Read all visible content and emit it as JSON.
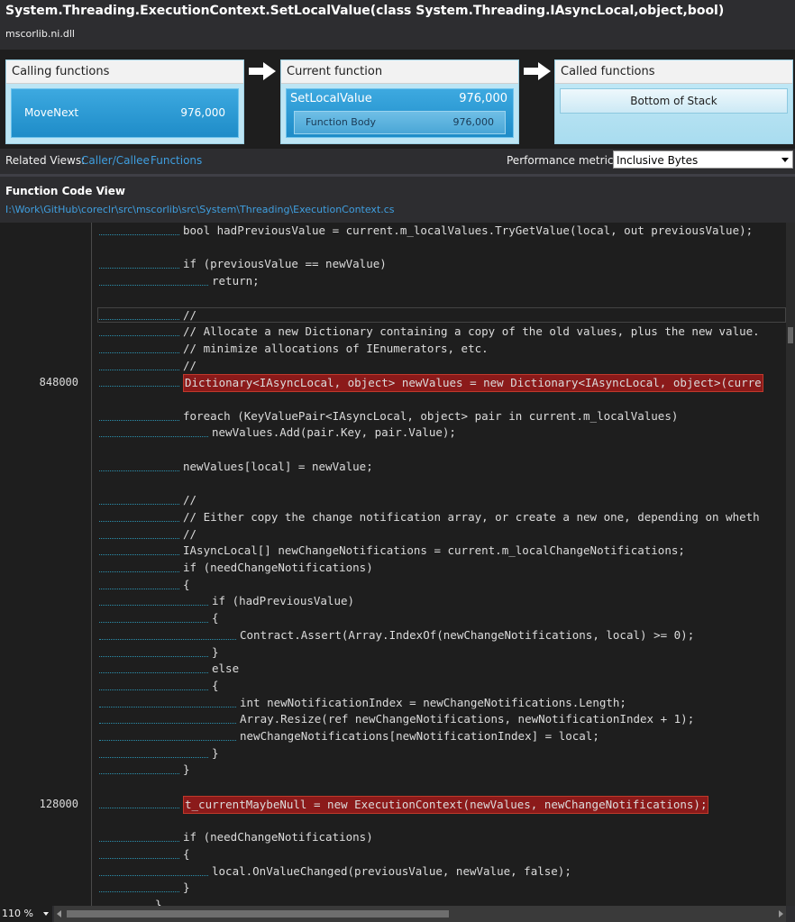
{
  "header": {
    "title": "System.Threading.ExecutionContext.SetLocalValue(class System.Threading.IAsyncLocal,object,bool)",
    "module": "mscorlib.ni.dll"
  },
  "calling": {
    "title": "Calling functions",
    "name": "MoveNext",
    "value": "976,000"
  },
  "current": {
    "title": "Current function",
    "name": "SetLocalValue",
    "value": "976,000",
    "body_label": "Function Body",
    "body_value": "976,000"
  },
  "called": {
    "title": "Called functions",
    "bottom_label": "Bottom of Stack"
  },
  "related": {
    "label": "Related Views:",
    "caller_callee": "Caller/Callee",
    "functions": "Functions",
    "metric_label": "Performance metric:",
    "metric_value": "Inclusive Bytes"
  },
  "code_view": {
    "title": "Function Code View",
    "path": "I:\\Work\\GitHub\\coreclr\\src\\mscorlib\\src\\System\\Threading\\ExecutionContext.cs",
    "lines": [
      {
        "num": "",
        "indent": 3,
        "text": "bool hadPreviousValue = current.m_localValues.TryGetValue(local, out previousValue);",
        "hot": false
      },
      {
        "num": "",
        "indent": 0,
        "text": "",
        "hot": false
      },
      {
        "num": "",
        "indent": 3,
        "text": "if (previousValue == newValue)",
        "hot": false
      },
      {
        "num": "",
        "indent": 4,
        "text": "return;",
        "hot": false
      },
      {
        "num": "",
        "indent": 0,
        "text": "",
        "hot": false
      },
      {
        "num": "",
        "indent": 3,
        "text": "//",
        "hot": false
      },
      {
        "num": "",
        "indent": 3,
        "text": "// Allocate a new Dictionary containing a copy of the old values, plus the new value.",
        "hot": false
      },
      {
        "num": "",
        "indent": 3,
        "text": "// minimize allocations of IEnumerators, etc.",
        "hot": false
      },
      {
        "num": "",
        "indent": 3,
        "text": "//",
        "hot": false
      },
      {
        "num": "848000",
        "indent": 3,
        "text": "Dictionary<IAsyncLocal, object> newValues = new Dictionary<IAsyncLocal, object>(curre",
        "hot": true
      },
      {
        "num": "",
        "indent": 0,
        "text": "",
        "hot": false
      },
      {
        "num": "",
        "indent": 3,
        "text": "foreach (KeyValuePair<IAsyncLocal, object> pair in current.m_localValues)",
        "hot": false
      },
      {
        "num": "",
        "indent": 4,
        "text": "newValues.Add(pair.Key, pair.Value);",
        "hot": false
      },
      {
        "num": "",
        "indent": 0,
        "text": "",
        "hot": false
      },
      {
        "num": "",
        "indent": 3,
        "text": "newValues[local] = newValue;",
        "hot": false
      },
      {
        "num": "",
        "indent": 0,
        "text": "",
        "hot": false
      },
      {
        "num": "",
        "indent": 3,
        "text": "//",
        "hot": false
      },
      {
        "num": "",
        "indent": 3,
        "text": "// Either copy the change notification array, or create a new one, depending on wheth",
        "hot": false
      },
      {
        "num": "",
        "indent": 3,
        "text": "//",
        "hot": false
      },
      {
        "num": "",
        "indent": 3,
        "text": "IAsyncLocal[] newChangeNotifications = current.m_localChangeNotifications;",
        "hot": false
      },
      {
        "num": "",
        "indent": 3,
        "text": "if (needChangeNotifications)",
        "hot": false
      },
      {
        "num": "",
        "indent": 3,
        "text": "{",
        "hot": false
      },
      {
        "num": "",
        "indent": 4,
        "text": "if (hadPreviousValue)",
        "hot": false
      },
      {
        "num": "",
        "indent": 4,
        "text": "{",
        "hot": false
      },
      {
        "num": "",
        "indent": 5,
        "text": "Contract.Assert(Array.IndexOf(newChangeNotifications, local) >= 0);",
        "hot": false
      },
      {
        "num": "",
        "indent": 4,
        "text": "}",
        "hot": false
      },
      {
        "num": "",
        "indent": 4,
        "text": "else",
        "hot": false
      },
      {
        "num": "",
        "indent": 4,
        "text": "{",
        "hot": false
      },
      {
        "num": "",
        "indent": 5,
        "text": "int newNotificationIndex = newChangeNotifications.Length;",
        "hot": false
      },
      {
        "num": "",
        "indent": 5,
        "text": "Array.Resize(ref newChangeNotifications, newNotificationIndex + 1);",
        "hot": false
      },
      {
        "num": "",
        "indent": 5,
        "text": "newChangeNotifications[newNotificationIndex] = local;",
        "hot": false
      },
      {
        "num": "",
        "indent": 4,
        "text": "}",
        "hot": false
      },
      {
        "num": "",
        "indent": 3,
        "text": "}",
        "hot": false
      },
      {
        "num": "",
        "indent": 0,
        "text": "",
        "hot": false
      },
      {
        "num": "128000",
        "indent": 3,
        "text": "t_currentMaybeNull = new ExecutionContext(newValues, newChangeNotifications);",
        "hot": true
      },
      {
        "num": "",
        "indent": 0,
        "text": "",
        "hot": false
      },
      {
        "num": "",
        "indent": 3,
        "text": "if (needChangeNotifications)",
        "hot": false
      },
      {
        "num": "",
        "indent": 3,
        "text": "{",
        "hot": false
      },
      {
        "num": "",
        "indent": 4,
        "text": "local.OnValueChanged(previousValue, newValue, false);",
        "hot": false
      },
      {
        "num": "",
        "indent": 3,
        "text": "}",
        "hot": false
      },
      {
        "num": "",
        "indent": 2,
        "text": "}",
        "hot": false
      }
    ]
  },
  "zoom": "110 %"
}
